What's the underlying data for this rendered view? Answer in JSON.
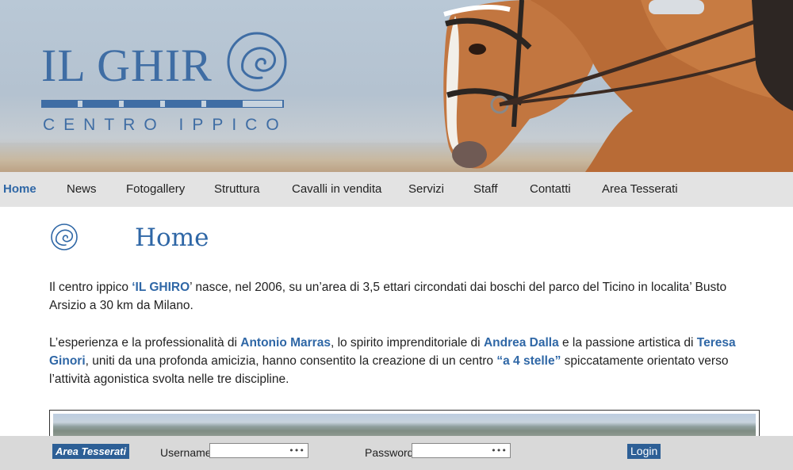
{
  "header": {
    "logo_title": "IL GHIR",
    "logo_subtitle": "CENTRO IPPICO"
  },
  "nav": {
    "items": [
      {
        "label": "Home",
        "active": true
      },
      {
        "label": "News"
      },
      {
        "label": "Fotogallery"
      },
      {
        "label": "Struttura"
      },
      {
        "label": "Cavalli in vendita"
      },
      {
        "label": "Servizi"
      },
      {
        "label": "Staff"
      },
      {
        "label": "Contatti"
      },
      {
        "label": "Area Tesserati"
      }
    ]
  },
  "main": {
    "title": "Home",
    "p1": {
      "t1": "Il centro ippico ",
      "hl1": "‘IL GHIRO",
      "t2": "’ nasce, nel 2006, su un’area di 3,5 ettari circondati dai boschi del parco del Ticino in localita’ Busto Arsizio a 30 km da Milano."
    },
    "p2": {
      "t1": "L’esperienza e la professionalità di ",
      "hl1": "Antonio Marras",
      "t2": ", lo spirito imprenditoriale di ",
      "hl2": "Andrea Dalla",
      "t3": " e la passione artistica di ",
      "hl3": "Teresa Ginori",
      "t4": ", uniti da una profonda amicizia, hanno consentito la creazione di un centro ",
      "hl4": "“a 4 stelle”",
      "t5": " spiccatamente orientato verso l’attività agonistica svolta nelle tre discipline."
    }
  },
  "loginbar": {
    "badge": "Area Tesserati",
    "username_label": "Username",
    "username_value": "•••",
    "password_label": "Password",
    "password_value": "•••",
    "login_label": "Login"
  },
  "colors": {
    "brand_blue": "#2f67a6",
    "nav_bg": "#e3e3e3",
    "loginbar_bg": "#d9d9d9"
  }
}
